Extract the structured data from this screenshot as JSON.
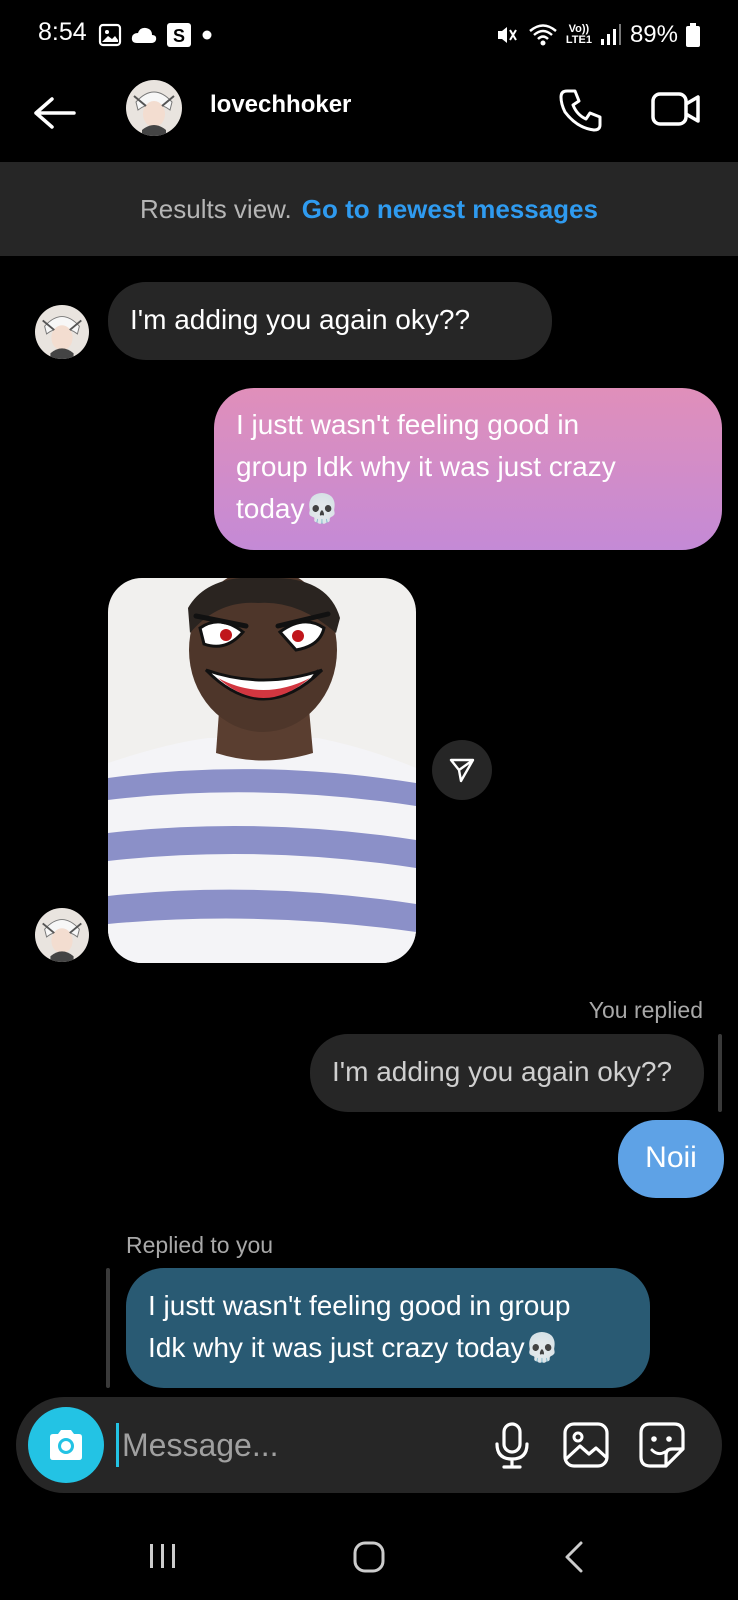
{
  "status_bar": {
    "time": "8:54",
    "battery": "89%",
    "network": "LTE1",
    "volte": "Vo))",
    "icons": [
      "gallery-icon",
      "cloud-icon",
      "s-app-icon",
      "dot-icon",
      "mute-icon",
      "wifi-icon",
      "signal-icon",
      "battery-icon"
    ]
  },
  "header": {
    "username": "lovechhoker",
    "icons": [
      "back-arrow-icon",
      "phone-icon",
      "video-camera-icon"
    ]
  },
  "banner": {
    "label": "Results view.",
    "link": "Go to newest messages",
    "link_color": "#2f9bf0"
  },
  "messages": {
    "m1": {
      "sender": "them",
      "text": "I'm adding you again oky??"
    },
    "m2": {
      "sender": "me",
      "line1": "I justt wasn't feeling good in",
      "line2": "group Idk why it was just crazy",
      "line3": "today💀"
    },
    "m3": {
      "sender": "them",
      "type": "photo",
      "icon": "share-icon"
    },
    "m4": {
      "sender": "me",
      "reply_label": "You replied",
      "quoted": "I'm adding you again oky??",
      "text": "Noii"
    },
    "m5": {
      "sender": "them",
      "reply_label": "Replied to you",
      "line1": "I justt wasn't feeling good in group",
      "line2": "Idk why it was just crazy today💀"
    }
  },
  "composer": {
    "placeholder": "Message...",
    "value": "",
    "icons": [
      "camera-icon",
      "microphone-icon",
      "gallery-icon",
      "sticker-icon"
    ],
    "accent": "#23c3e4"
  },
  "colors": {
    "background": "#000000",
    "incoming_bubble": "#262626",
    "outgoing_pink_top": "#e08fba",
    "outgoing_pink_bottom": "#c48ad6",
    "outgoing_blue": "#5ea2e6",
    "incoming_reply_bubble": "#295a73"
  },
  "nav_bar": {
    "icons": [
      "recents-icon",
      "home-icon",
      "back-icon"
    ]
  }
}
